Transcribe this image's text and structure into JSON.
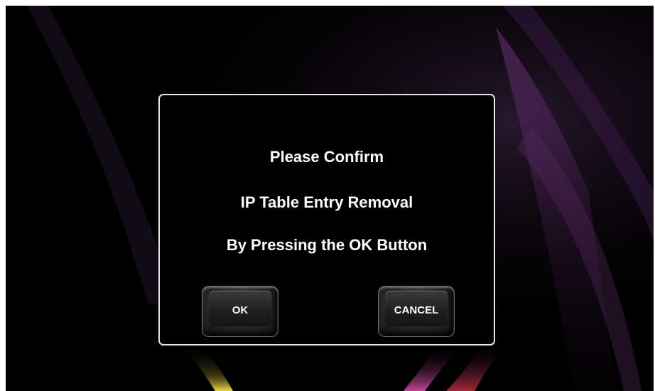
{
  "dialog": {
    "line1": "Please Confirm",
    "line2": "IP Table Entry Removal",
    "line3": "By Pressing the OK Button"
  },
  "buttons": {
    "ok_label": "OK",
    "cancel_label": "CANCEL"
  },
  "colors": {
    "screen_background": "#000000",
    "dialog_border": "#e6e6e6",
    "text": "#ffffff",
    "light_streak_purple": "#8a3c8c",
    "light_streak_yellow": "#e8d23a",
    "light_streak_red": "#b8324a"
  }
}
